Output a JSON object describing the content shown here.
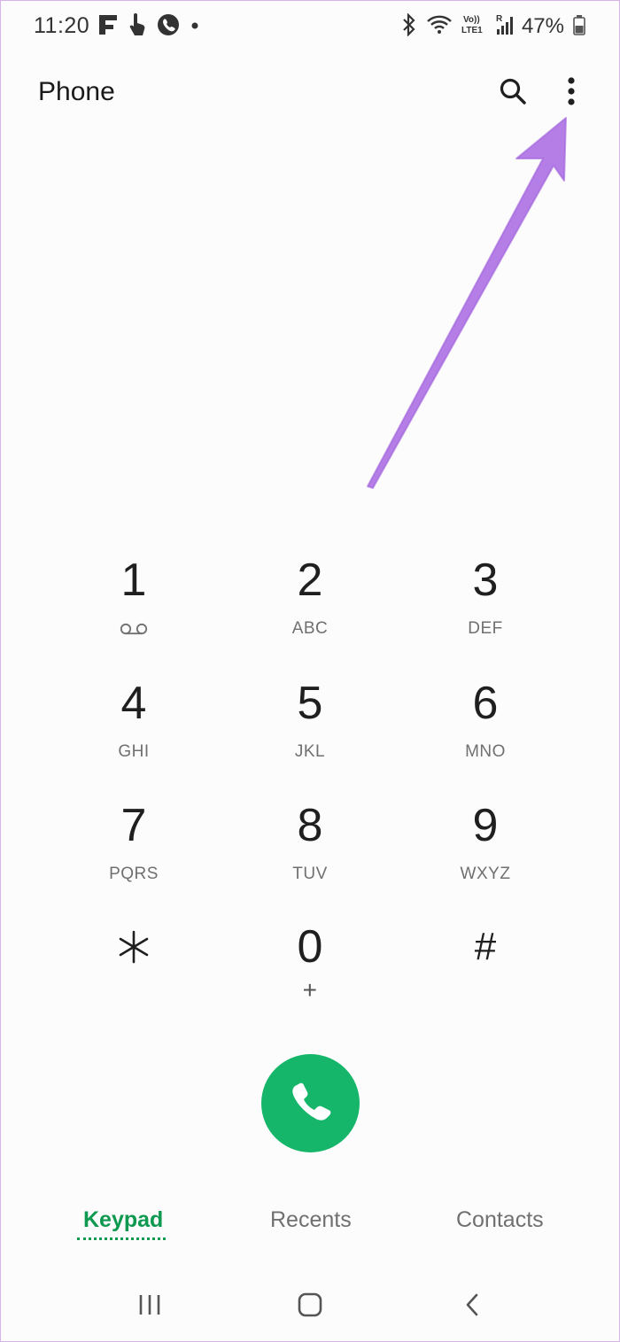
{
  "status_bar": {
    "time": "11:20",
    "battery_percent": "47%",
    "left_icons": [
      "flipboard-icon",
      "touch-icon",
      "phone-call-icon",
      "dot-icon"
    ],
    "right_icons": [
      "bluetooth-icon",
      "wifi-icon",
      "volte-icon",
      "signal-icon",
      "battery-icon"
    ]
  },
  "app_bar": {
    "title": "Phone",
    "actions": [
      "search-icon",
      "more-options-icon"
    ]
  },
  "keypad": {
    "keys": [
      {
        "digit": "1",
        "letters": "",
        "icon": "voicemail-icon"
      },
      {
        "digit": "2",
        "letters": "ABC"
      },
      {
        "digit": "3",
        "letters": "DEF"
      },
      {
        "digit": "4",
        "letters": "GHI"
      },
      {
        "digit": "5",
        "letters": "JKL"
      },
      {
        "digit": "6",
        "letters": "MNO"
      },
      {
        "digit": "7",
        "letters": "PQRS"
      },
      {
        "digit": "8",
        "letters": "TUV"
      },
      {
        "digit": "9",
        "letters": "WXYZ"
      },
      {
        "digit": "*",
        "letters": ""
      },
      {
        "digit": "0",
        "letters": "+"
      },
      {
        "digit": "#",
        "letters": ""
      }
    ]
  },
  "call_button": {
    "icon": "phone-icon",
    "color": "#16b66a"
  },
  "tabs": {
    "items": [
      {
        "label": "Keypad",
        "active": true
      },
      {
        "label": "Recents",
        "active": false
      },
      {
        "label": "Contacts",
        "active": false
      }
    ],
    "active_color": "#0e9950"
  },
  "nav_bar": {
    "buttons": [
      "recent-apps-icon",
      "home-icon",
      "back-icon"
    ]
  },
  "annotation": {
    "color": "#b57ee6",
    "icon": "pointer-arrow"
  }
}
